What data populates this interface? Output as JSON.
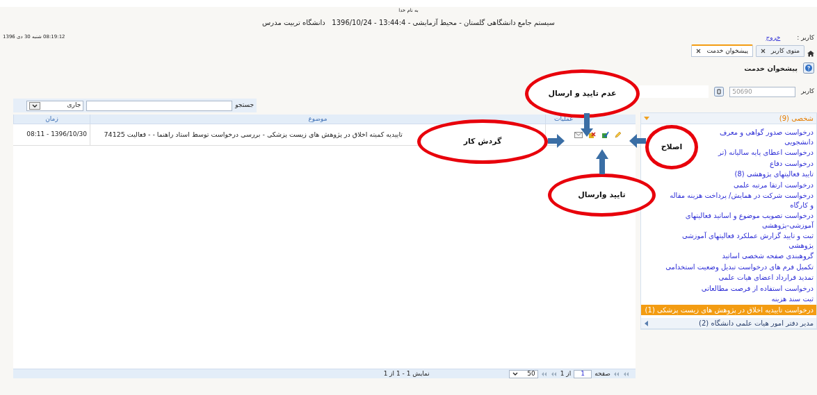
{
  "header": {
    "greeting": "به نام خدا",
    "title": "سیستم جامع دانشگاهی گلستان - محیط آزمایشی - 13:44:4 - 1396/10/24   دانشگاه تربیت مدرس",
    "datetime": "08:19:12 شنبه 30 دی 1396",
    "user_label": "کاربر :",
    "logout": "خروج"
  },
  "tabs": [
    {
      "label": "منوی کاربر",
      "selected": false
    },
    {
      "label": "پیشخوان خدمت",
      "selected": true
    }
  ],
  "page_title": "پیشخوان خدمت",
  "user_filter": {
    "label": "کاربر",
    "value": "50690"
  },
  "search": {
    "label": "جستجو",
    "status": "جاری"
  },
  "table": {
    "columns": [
      "عملیات",
      "موضوع",
      "زمان"
    ],
    "rows": [
      {
        "subject": "تاییدیه کمیته اخلاق در پژوهش های زیست پزشکی - بررسی درخواست توسط استاد راهنما - - فعالیت 74125",
        "time": "1396/10/30 - 08:11"
      }
    ]
  },
  "pager": {
    "page_label": "صفحه",
    "page": "1",
    "of": "از 1",
    "page_size": "50",
    "summary": "نمایش 1 - 1 از 1"
  },
  "sidebar": {
    "groups": [
      {
        "title": "شخصی (9)",
        "expanded": true,
        "items": [
          {
            "text": "درخواست صدور گواهی و معرف\nدانشجویی",
            "selected": false
          },
          {
            "text": "درخواست اعطای پایه سالیانه (تر",
            "selected": false
          },
          {
            "text": "درخواست دفاع",
            "selected": false
          },
          {
            "text": "تایید فعالیتهای پژوهشی (8)",
            "selected": false
          },
          {
            "text": "درخواست ارتقا مرتبه علمی",
            "selected": false
          },
          {
            "text": "درخواست شرکت در همایش/ پرداخت هزینه مقاله و کارگاه",
            "selected": false
          },
          {
            "text": "درخواست تصویب موضوع و اساتید فعالیتهای آموزشی-پژوهشی",
            "selected": false
          },
          {
            "text": "ثبت و تایید گزارش عملکرد فعالیتهای آموزشی پژوهشی",
            "selected": false
          },
          {
            "text": "گروهبندی صفحه شخصی اساتید",
            "selected": false
          },
          {
            "text": "تکمیل فرم های درخواست تبدیل وضعیت استخدامی",
            "selected": false
          },
          {
            "text": "تمدید قرارداد اعضای هیات علمی",
            "selected": false
          },
          {
            "text": "درخواست استفاده از فرصت مطالعاتی",
            "selected": false
          },
          {
            "text": "ثبت سند هزینه",
            "selected": false
          },
          {
            "text": "درخواست تاییدیه اخلاق در پژوهش های زیست پزشکی (1)",
            "selected": true
          }
        ]
      },
      {
        "title": "مدیر دفتر امور هیات علمی دانشگاه (2)",
        "expanded": false
      }
    ]
  },
  "annotations": [
    {
      "text": "عدم تایید و ارسال",
      "kind": "down"
    },
    {
      "text": "گردش کار",
      "kind": "right"
    },
    {
      "text": "اصلاح",
      "kind": "left"
    },
    {
      "text": "تایید وارسال",
      "kind": "up"
    }
  ]
}
